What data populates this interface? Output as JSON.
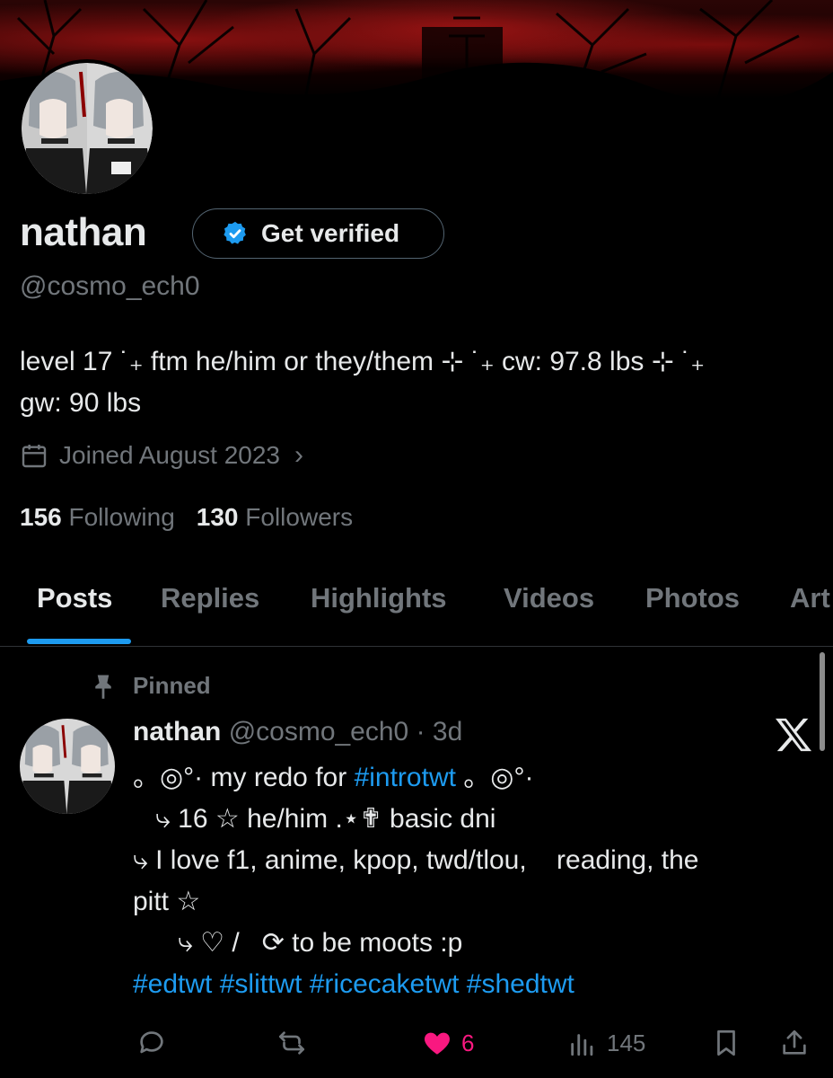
{
  "profile": {
    "name": "nathan",
    "verify_label": "Get verified",
    "handle": "@cosmo_ech0",
    "bio_line1": "level 17 ˙₊ ftm he/him or they/them ⊹ ˙₊ cw: 97.8 lbs ⊹ ˙₊",
    "bio_line2": "gw: 90 lbs",
    "joined": "Joined August 2023",
    "following_count": "156",
    "following_label": "Following",
    "followers_count": "130",
    "followers_label": "Followers"
  },
  "tabs": [
    {
      "label": "Posts",
      "active": true
    },
    {
      "label": "Replies"
    },
    {
      "label": "Highlights"
    },
    {
      "label": "Videos"
    },
    {
      "label": "Photos"
    },
    {
      "label": "Art"
    }
  ],
  "post": {
    "pinned_label": "Pinned",
    "author": "nathan",
    "handle_time": "@cosmo_ech0 · 3d",
    "line1_pre": "。◎°· my redo for ",
    "line1_hash": "#introtwt",
    "line1_post": " 。◎°·",
    "line2": "   ⤷ 16 ☆ he/him .⋆✟ basic dni",
    "line3": "⤷ I love f1, anime, kpop, twd/tlou,    reading, the",
    "line4": "pitt ☆",
    "line5": "      ⤷ ♡ /   ⟳ to be moots :p",
    "hashtags": "#edtwt #slittwt #ricecaketwt #shedtwt",
    "likes": "6",
    "views": "145"
  },
  "colors": {
    "accent": "#1d9bf0",
    "like": "#f91880",
    "muted": "#71767b",
    "text": "#e7e9ea"
  },
  "icons": [
    "calendar-icon",
    "verified-badge-icon",
    "pin-icon",
    "x-logo-icon",
    "reply-icon",
    "repost-icon",
    "heart-icon",
    "views-icon",
    "bookmark-icon",
    "share-icon"
  ]
}
